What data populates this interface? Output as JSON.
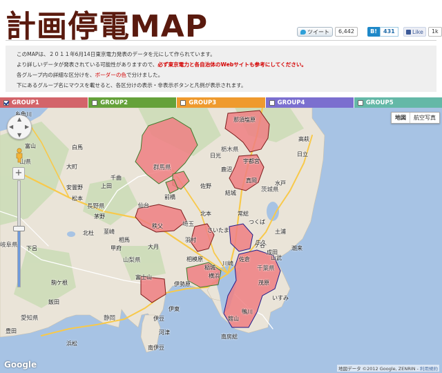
{
  "header": {
    "title": "計画停電MAP",
    "tweet_label": "ツイート",
    "tweet_count": "6,442",
    "hatena_label": "B!",
    "hatena_count": "431",
    "like_label": "Like",
    "like_count": "1k"
  },
  "info": {
    "line1": "このMAPは、２０１１年6月14日東京電力発表のデータを元にして作られています。",
    "line2_prefix": "より詳しいデータが発表されている可能性がありますので、",
    "line2_warning": "必ず東京電力と各自治体のWebサイトも参考にしてください。",
    "line3_prefix": "各グループ内の詳細な区分けを、",
    "line3_highlight": "ボーダーの色",
    "line3_suffix": "で分けました。",
    "line4": "下にあるグループ名にマウスを載せると、各区分けの表示・非表示ボタンと凡例が表示されます。"
  },
  "groups": [
    {
      "label": "GROUP1",
      "color": "#d3646a",
      "checked": true
    },
    {
      "label": "GROUP2",
      "color": "#65a13a",
      "checked": false
    },
    {
      "label": "GROUP3",
      "color": "#ef9a2e",
      "checked": false
    },
    {
      "label": "GROUP4",
      "color": "#7b6fcf",
      "checked": false
    },
    {
      "label": "GROUP5",
      "color": "#64b8a7",
      "checked": false
    }
  ],
  "map": {
    "map_button": "地図",
    "satellite_button": "航空写真",
    "logo": "Google",
    "attribution": "地図データ ©2012 Google, ZENRIN - ",
    "terms_link": "利用規約",
    "zoom_level": 0.55,
    "labels": [
      {
        "text": "糸魚川"
      },
      {
        "text": "富山"
      },
      {
        "text": "山県"
      },
      {
        "text": "大町"
      },
      {
        "text": "白馬"
      },
      {
        "text": "安曇野"
      },
      {
        "text": "松本"
      },
      {
        "text": "長野県"
      },
      {
        "text": "上田"
      },
      {
        "text": "茅野"
      },
      {
        "text": "群馬県"
      },
      {
        "text": "前橋"
      },
      {
        "text": "那須塩原"
      },
      {
        "text": "栃木県"
      },
      {
        "text": "宇都宮"
      },
      {
        "text": "鹿沼"
      },
      {
        "text": "佐野"
      },
      {
        "text": "茨城県"
      },
      {
        "text": "日立"
      },
      {
        "text": "水戸"
      },
      {
        "text": "つくば"
      },
      {
        "text": "土浦"
      },
      {
        "text": "常総"
      },
      {
        "text": "埼玉"
      },
      {
        "text": "さいたま"
      },
      {
        "text": "秩父"
      },
      {
        "text": "羽村"
      },
      {
        "text": "山梨県"
      },
      {
        "text": "甲府"
      },
      {
        "text": "相模原"
      },
      {
        "text": "川崎"
      },
      {
        "text": "横浜"
      },
      {
        "text": "富士山"
      },
      {
        "text": "静岡"
      },
      {
        "text": "伊東"
      },
      {
        "text": "館山"
      },
      {
        "text": "千葉県"
      },
      {
        "text": "茂原"
      },
      {
        "text": "鴨川"
      },
      {
        "text": "いすみ"
      },
      {
        "text": "駒ケ根"
      },
      {
        "text": "飯田"
      },
      {
        "text": "下呂"
      },
      {
        "text": "岐阜県"
      },
      {
        "text": "愛知県"
      },
      {
        "text": "豊田"
      },
      {
        "text": "浜松"
      },
      {
        "text": "伊豆"
      },
      {
        "text": "南伊豆"
      },
      {
        "text": "河津"
      },
      {
        "text": "稲城"
      },
      {
        "text": "仙台"
      },
      {
        "text": "相馬"
      },
      {
        "text": "牛久"
      },
      {
        "text": "成田"
      },
      {
        "text": "佐倉"
      },
      {
        "text": "ケ谷"
      },
      {
        "text": "山武"
      },
      {
        "text": "北本"
      },
      {
        "text": "伊勢原"
      },
      {
        "text": "韮崎"
      },
      {
        "text": "大月"
      },
      {
        "text": "北杜"
      },
      {
        "text": "千曲"
      },
      {
        "text": "日光"
      },
      {
        "text": "真岡"
      },
      {
        "text": "結城"
      },
      {
        "text": "高萩"
      },
      {
        "text": "潮来"
      },
      {
        "text": "南房総"
      }
    ]
  }
}
